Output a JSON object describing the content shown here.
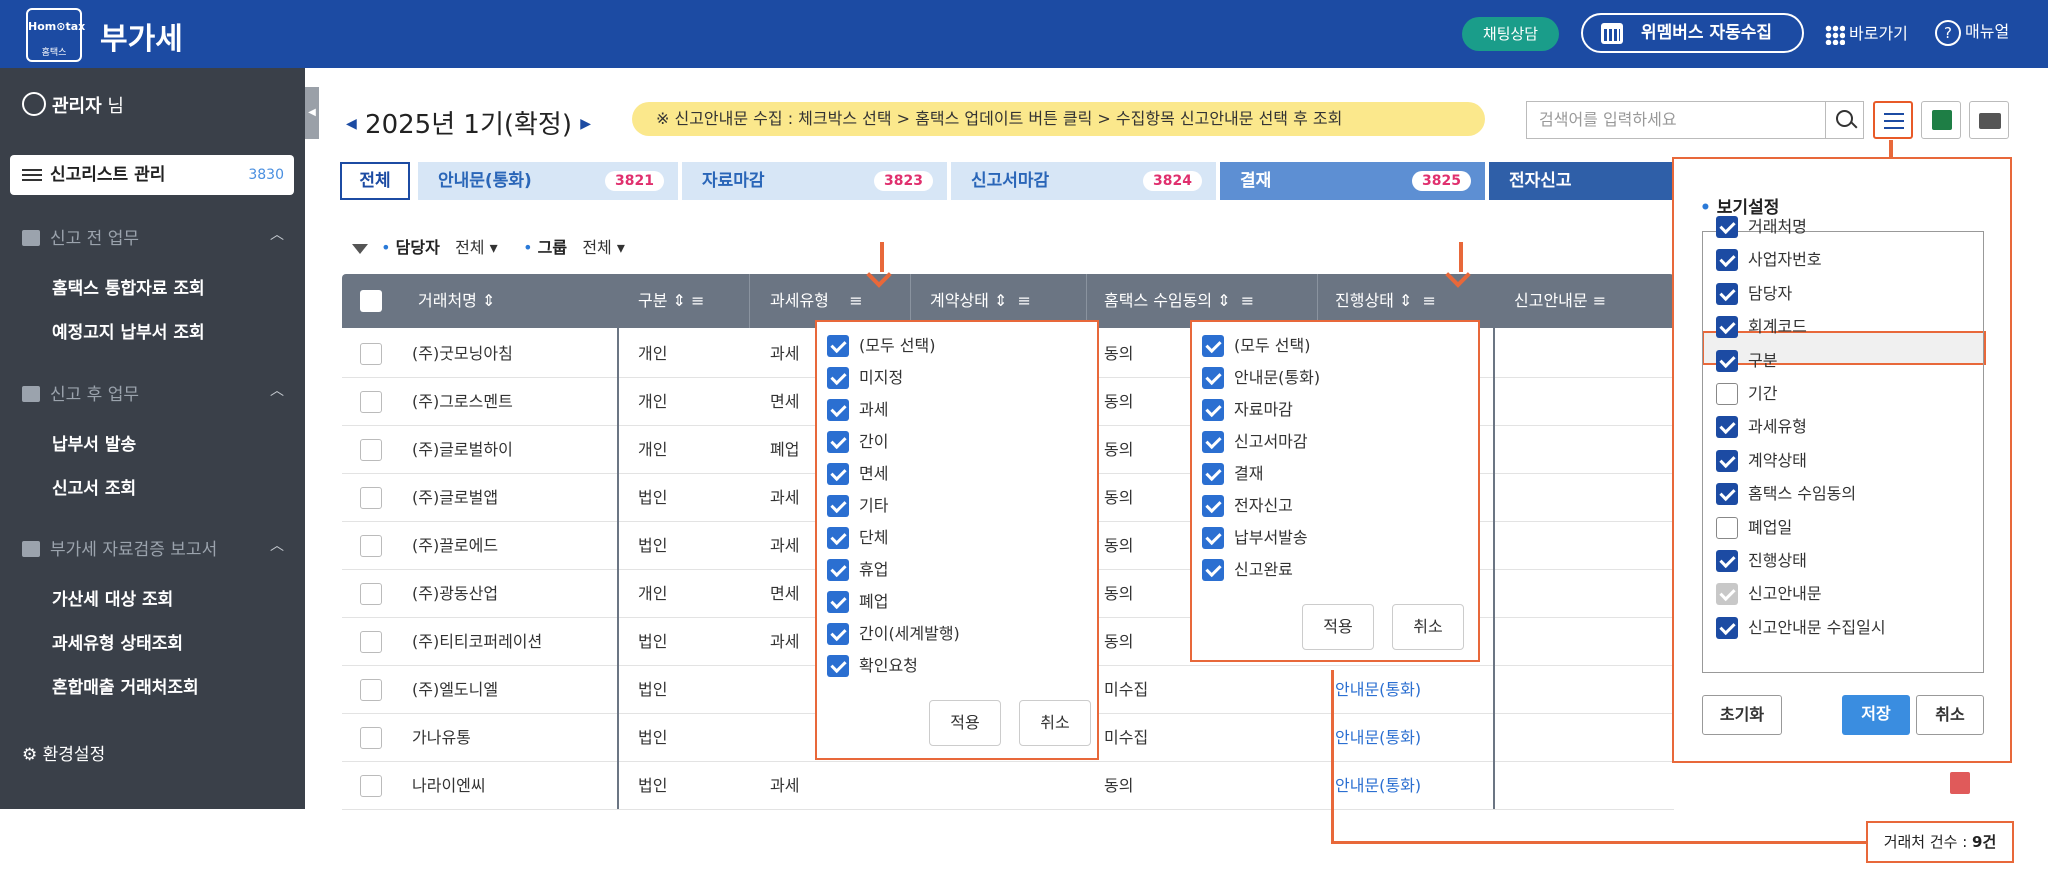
{
  "header": {
    "logo_line1": "Hom⊙tax",
    "logo_line2": "홈택스",
    "title": "부가세",
    "chat_button": "채팅상담",
    "wemem_button": "위멤버스 자동수집",
    "shortcut": "바로가기",
    "manual": "매뉴얼"
  },
  "sidebar": {
    "admin_name": "관리자",
    "admin_suffix": " 님",
    "active_menu": "신고리스트 관리",
    "active_count": "3830",
    "sections": [
      {
        "title": "신고 전 업무",
        "items": [
          "홈택스 통합자료 조회",
          "예정고지 납부서 조회"
        ]
      },
      {
        "title": "신고 후 업무",
        "items": [
          "납부서 발송",
          "신고서 조회"
        ]
      },
      {
        "title": "부가세 자료검증 보고서",
        "items": [
          "가산세 대상 조회",
          "과세유형 상태조회",
          "혼합매출 거래처조회"
        ]
      }
    ],
    "settings": "환경설정"
  },
  "toolbar": {
    "period": "2025년 1기(확정)",
    "notice": "※ 신고안내문 수집 : 체크박스 선택 > 홈택스 업데이트 버튼 클릭 > 수집항목 신고안내문 선택 후 조회",
    "search_placeholder": "검색어를 입력하세요"
  },
  "stages": {
    "all": "전체",
    "items": [
      {
        "label": "안내문(통화)",
        "count": "3821"
      },
      {
        "label": "자료마감",
        "count": "3823"
      },
      {
        "label": "신고서마감",
        "count": "3824"
      },
      {
        "label": "결재",
        "count": "3825"
      },
      {
        "label": "전자신고",
        "count": ""
      }
    ]
  },
  "filters": {
    "manager_label": "담당자",
    "manager_value": "전체",
    "group_label": "그룹",
    "group_value": "전체"
  },
  "table": {
    "headers": [
      "거래처명",
      "구분",
      "과세유형",
      "계약상태",
      "홈택스 수임동의",
      "진행상태",
      "신고안내문"
    ],
    "rows": [
      {
        "name": "(주)굿모닝아침",
        "type": "개인",
        "tax": "과세",
        "contract": "",
        "consent": "동의",
        "status": ""
      },
      {
        "name": "(주)그로스멘트",
        "type": "개인",
        "tax": "면세",
        "contract": "",
        "consent": "동의",
        "status": ""
      },
      {
        "name": "(주)글로벌하이",
        "type": "개인",
        "tax": "폐업",
        "contract": "",
        "consent": "동의",
        "status": ""
      },
      {
        "name": "(주)글로벌앱",
        "type": "법인",
        "tax": "과세",
        "contract": "",
        "consent": "동의",
        "status": ""
      },
      {
        "name": "(주)끌로에드",
        "type": "법인",
        "tax": "과세",
        "contract": "",
        "consent": "동의",
        "status": ""
      },
      {
        "name": "(주)광동산업",
        "type": "개인",
        "tax": "면세",
        "contract": "",
        "consent": "동의",
        "status": ""
      },
      {
        "name": "(주)티티코퍼레이션",
        "type": "법인",
        "tax": "과세",
        "contract": "",
        "consent": "동의",
        "status": ""
      },
      {
        "name": "(주)엘도니엘",
        "type": "법인",
        "tax": "",
        "contract": "",
        "consent": "미수집",
        "status": "안내문(통화)"
      },
      {
        "name": "가나유통",
        "type": "법인",
        "tax": "",
        "contract": "",
        "consent": "미수집",
        "status": "안내문(통화)"
      },
      {
        "name": "나라이엔씨",
        "type": "법인",
        "tax": "과세",
        "contract": "",
        "consent": "동의",
        "status": "안내문(통화)"
      }
    ]
  },
  "tax_filter_popup": {
    "items": [
      "(모두 선택)",
      "미지정",
      "과세",
      "간이",
      "면세",
      "기타",
      "단체",
      "휴업",
      "폐업",
      "간이(세계발행)",
      "확인요청"
    ],
    "apply": "적용",
    "cancel": "취소"
  },
  "status_filter_popup": {
    "items": [
      "(모두 선택)",
      "안내문(통화)",
      "자료마감",
      "신고서마감",
      "결재",
      "전자신고",
      "납부서발송",
      "신고완료"
    ],
    "apply": "적용",
    "cancel": "취소"
  },
  "view_settings": {
    "title": "보기설정",
    "items": [
      {
        "label": "거래처명",
        "state": "on"
      },
      {
        "label": "사업자번호",
        "state": "on"
      },
      {
        "label": "담당자",
        "state": "on"
      },
      {
        "label": "회계코드",
        "state": "on"
      },
      {
        "label": "구분",
        "state": "on"
      },
      {
        "label": "기간",
        "state": "off"
      },
      {
        "label": "과세유형",
        "state": "on"
      },
      {
        "label": "계약상태",
        "state": "on"
      },
      {
        "label": "홈택스 수임동의",
        "state": "on"
      },
      {
        "label": "폐업일",
        "state": "off"
      },
      {
        "label": "진행상태",
        "state": "on"
      },
      {
        "label": "신고안내문",
        "state": "disabled"
      },
      {
        "label": "신고안내문 수집일시",
        "state": "on"
      }
    ],
    "reset": "초기화",
    "save": "저장",
    "cancel": "취소"
  },
  "footer": {
    "count_label": "거래처 건수 : ",
    "count_value": "9건"
  },
  "colors": {
    "header_bg": "#1c4ba3",
    "sidebar_bg": "#3a4049",
    "highlight": "#e8683a",
    "notice_bg": "#fbe88c"
  }
}
